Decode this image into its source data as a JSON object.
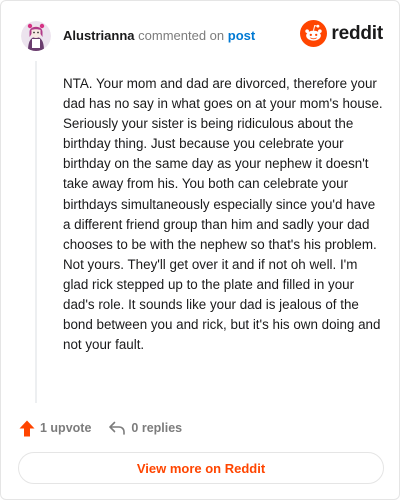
{
  "header": {
    "author": "Alustrianna",
    "action_text": "commented on",
    "post_link": "post",
    "brand_wordmark": "reddit"
  },
  "comment": {
    "body": "NTA. Your mom and dad are divorced, therefore your dad has no say in what goes on at your mom's house. Seriously your sister is being ridiculous about the birthday thing. Just because you celebrate your birthday on the same day as your nephew it doesn't take away from his. You both can celebrate your birthdays simultaneously especially since you'd have a different friend group than him and sadly your dad chooses to be with the nephew so that's his problem. Not yours. They'll get over it and if not oh well. I'm glad rick stepped up to the plate and filled in your dad's role. It sounds like your dad is jealous of the bond between you and rick, but it's his own doing and not your fault."
  },
  "actions": {
    "upvotes": "1 upvote",
    "replies": "0 replies"
  },
  "footer": {
    "view_more": "View more on Reddit"
  },
  "icons": {
    "upvote": "upvote-arrow-icon",
    "reply": "reply-arrow-icon",
    "logo": "reddit-snoo-icon"
  },
  "colors": {
    "accent": "#ff4500",
    "link": "#0079d3",
    "muted": "#7c7c7c"
  }
}
